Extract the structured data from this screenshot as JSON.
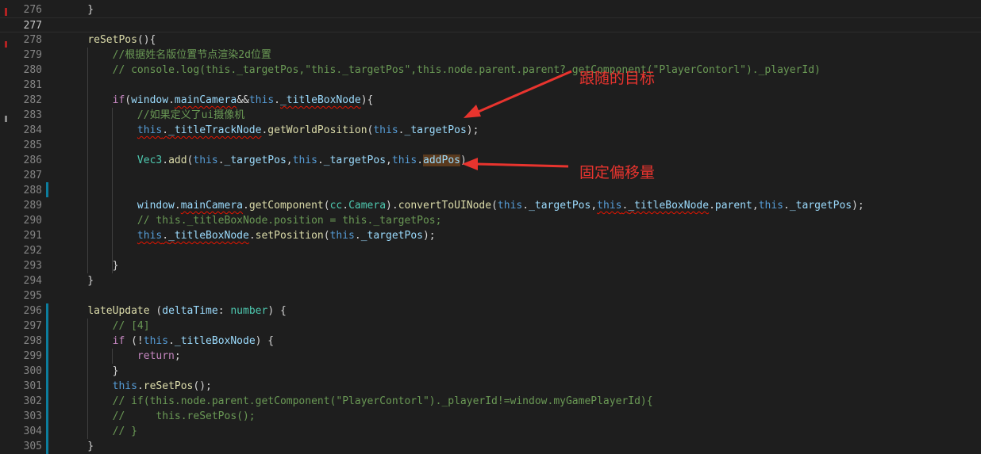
{
  "lines": [
    {
      "n": "276",
      "tokens": [
        {
          "t": "    }"
        }
      ]
    },
    {
      "n": "277",
      "active": true,
      "tokens": [
        {
          "t": ""
        }
      ]
    },
    {
      "n": "278",
      "tokens": [
        {
          "t": "    "
        },
        {
          "t": "reSetPos",
          "c": "fn"
        },
        {
          "t": "(){"
        }
      ]
    },
    {
      "n": "279",
      "tokens": [
        {
          "t": "        "
        },
        {
          "t": "//根据姓名版位置节点渲染2d位置",
          "c": "cm"
        }
      ]
    },
    {
      "n": "280",
      "tokens": [
        {
          "t": "        "
        },
        {
          "t": "// console.log(this._targetPos,\"this._targetPos\",this.node.parent.parent?.getComponent(\"PlayerContorl\")._playerId)",
          "c": "cm"
        }
      ]
    },
    {
      "n": "281",
      "tokens": [
        {
          "t": ""
        }
      ]
    },
    {
      "n": "282",
      "tokens": [
        {
          "t": "        "
        },
        {
          "t": "if",
          "c": "ctl"
        },
        {
          "t": "("
        },
        {
          "t": "window",
          "c": "prop"
        },
        {
          "t": "."
        },
        {
          "t": "mainCamera",
          "c": "prop sq"
        },
        {
          "t": "&&"
        },
        {
          "t": "this",
          "c": "kw"
        },
        {
          "t": "."
        },
        {
          "t": "_titleBoxNode",
          "c": "prop sq"
        },
        {
          "t": "){"
        }
      ]
    },
    {
      "n": "283",
      "tokens": [
        {
          "t": "            "
        },
        {
          "t": "//如果定义了ui摄像机",
          "c": "cm"
        }
      ]
    },
    {
      "n": "284",
      "tokens": [
        {
          "t": "            "
        },
        {
          "t": "this",
          "c": "kw sq"
        },
        {
          "t": ".",
          "c": "sq"
        },
        {
          "t": "_titleTrackNode",
          "c": "prop sq"
        },
        {
          "t": "."
        },
        {
          "t": "getWorldPosition",
          "c": "fn"
        },
        {
          "t": "("
        },
        {
          "t": "this",
          "c": "kw"
        },
        {
          "t": "."
        },
        {
          "t": "_targetPos",
          "c": "prop"
        },
        {
          "t": ");"
        }
      ]
    },
    {
      "n": "285",
      "tokens": [
        {
          "t": ""
        }
      ]
    },
    {
      "n": "286",
      "tokens": [
        {
          "t": "            "
        },
        {
          "t": "Vec3",
          "c": "ty"
        },
        {
          "t": "."
        },
        {
          "t": "add",
          "c": "fn"
        },
        {
          "t": "("
        },
        {
          "t": "this",
          "c": "kw"
        },
        {
          "t": "."
        },
        {
          "t": "_targetPos",
          "c": "prop"
        },
        {
          "t": ","
        },
        {
          "t": "this",
          "c": "kw"
        },
        {
          "t": "."
        },
        {
          "t": "_targetPos",
          "c": "prop"
        },
        {
          "t": ","
        },
        {
          "t": "this",
          "c": "kw"
        },
        {
          "t": "."
        },
        {
          "t": "addPos",
          "c": "prop hl"
        },
        {
          "t": ")"
        }
      ]
    },
    {
      "n": "287",
      "tokens": [
        {
          "t": ""
        }
      ]
    },
    {
      "n": "288",
      "tokens": [
        {
          "t": ""
        }
      ]
    },
    {
      "n": "289",
      "tokens": [
        {
          "t": "            "
        },
        {
          "t": "window",
          "c": "prop"
        },
        {
          "t": "."
        },
        {
          "t": "mainCamera",
          "c": "prop sq"
        },
        {
          "t": "."
        },
        {
          "t": "getComponent",
          "c": "fn"
        },
        {
          "t": "("
        },
        {
          "t": "cc",
          "c": "ty"
        },
        {
          "t": "."
        },
        {
          "t": "Camera",
          "c": "ty"
        },
        {
          "t": ")."
        },
        {
          "t": "convertToUINode",
          "c": "fn"
        },
        {
          "t": "("
        },
        {
          "t": "this",
          "c": "kw"
        },
        {
          "t": "."
        },
        {
          "t": "_targetPos",
          "c": "prop"
        },
        {
          "t": ","
        },
        {
          "t": "this",
          "c": "kw sq"
        },
        {
          "t": ".",
          "c": "sq"
        },
        {
          "t": "_titleBoxNode",
          "c": "prop sq"
        },
        {
          "t": "."
        },
        {
          "t": "parent",
          "c": "prop"
        },
        {
          "t": ","
        },
        {
          "t": "this",
          "c": "kw"
        },
        {
          "t": "."
        },
        {
          "t": "_targetPos",
          "c": "prop"
        },
        {
          "t": ");"
        }
      ]
    },
    {
      "n": "290",
      "tokens": [
        {
          "t": "            "
        },
        {
          "t": "// this._titleBoxNode.position = this._targetPos;",
          "c": "cm"
        }
      ]
    },
    {
      "n": "291",
      "tokens": [
        {
          "t": "            "
        },
        {
          "t": "this",
          "c": "kw sq"
        },
        {
          "t": ".",
          "c": "sq"
        },
        {
          "t": "_titleBoxNode",
          "c": "prop sq"
        },
        {
          "t": "."
        },
        {
          "t": "setPosition",
          "c": "fn"
        },
        {
          "t": "("
        },
        {
          "t": "this",
          "c": "kw"
        },
        {
          "t": "."
        },
        {
          "t": "_targetPos",
          "c": "prop"
        },
        {
          "t": ");"
        }
      ]
    },
    {
      "n": "292",
      "tokens": [
        {
          "t": ""
        }
      ]
    },
    {
      "n": "293",
      "tokens": [
        {
          "t": "        }"
        }
      ]
    },
    {
      "n": "294",
      "tokens": [
        {
          "t": "    }"
        }
      ]
    },
    {
      "n": "295",
      "tokens": [
        {
          "t": ""
        }
      ]
    },
    {
      "n": "296",
      "tokens": [
        {
          "t": "    "
        },
        {
          "t": "lateUpdate",
          "c": "fn"
        },
        {
          "t": " ("
        },
        {
          "t": "deltaTime",
          "c": "prop"
        },
        {
          "t": ": "
        },
        {
          "t": "number",
          "c": "ty"
        },
        {
          "t": ") {"
        }
      ]
    },
    {
      "n": "297",
      "tokens": [
        {
          "t": "        "
        },
        {
          "t": "// [4]",
          "c": "cm"
        }
      ]
    },
    {
      "n": "298",
      "tokens": [
        {
          "t": "        "
        },
        {
          "t": "if",
          "c": "ctl"
        },
        {
          "t": " (!"
        },
        {
          "t": "this",
          "c": "kw"
        },
        {
          "t": "."
        },
        {
          "t": "_titleBoxNode",
          "c": "prop"
        },
        {
          "t": ") {"
        }
      ]
    },
    {
      "n": "299",
      "tokens": [
        {
          "t": "            "
        },
        {
          "t": "return",
          "c": "ctl"
        },
        {
          "t": ";"
        }
      ]
    },
    {
      "n": "300",
      "tokens": [
        {
          "t": "        }"
        }
      ]
    },
    {
      "n": "301",
      "tokens": [
        {
          "t": "        "
        },
        {
          "t": "this",
          "c": "kw"
        },
        {
          "t": "."
        },
        {
          "t": "reSetPos",
          "c": "fn"
        },
        {
          "t": "();"
        }
      ]
    },
    {
      "n": "302",
      "tokens": [
        {
          "t": "        "
        },
        {
          "t": "// if(this.node.parent.getComponent(\"PlayerContorl\")._playerId!=window.myGamePlayerId){",
          "c": "cm"
        }
      ]
    },
    {
      "n": "303",
      "tokens": [
        {
          "t": "        "
        },
        {
          "t": "//     this.reSetPos();",
          "c": "cm"
        }
      ]
    },
    {
      "n": "304",
      "tokens": [
        {
          "t": "        "
        },
        {
          "t": "// }",
          "c": "cm"
        }
      ]
    },
    {
      "n": "305",
      "tokens": [
        {
          "t": "    }"
        }
      ]
    }
  ],
  "annotations": {
    "follow_target": "跟随的目标",
    "fixed_offset": "固定偏移量"
  },
  "colors": {
    "background": "#1e1e1e",
    "annotation_red": "#e8342e",
    "comment": "#6a9955",
    "keyword": "#569cd6",
    "function": "#dcdcaa",
    "property": "#9cdcfe",
    "string": "#ce9178",
    "type": "#4ec9b0",
    "control": "#c586c0"
  }
}
